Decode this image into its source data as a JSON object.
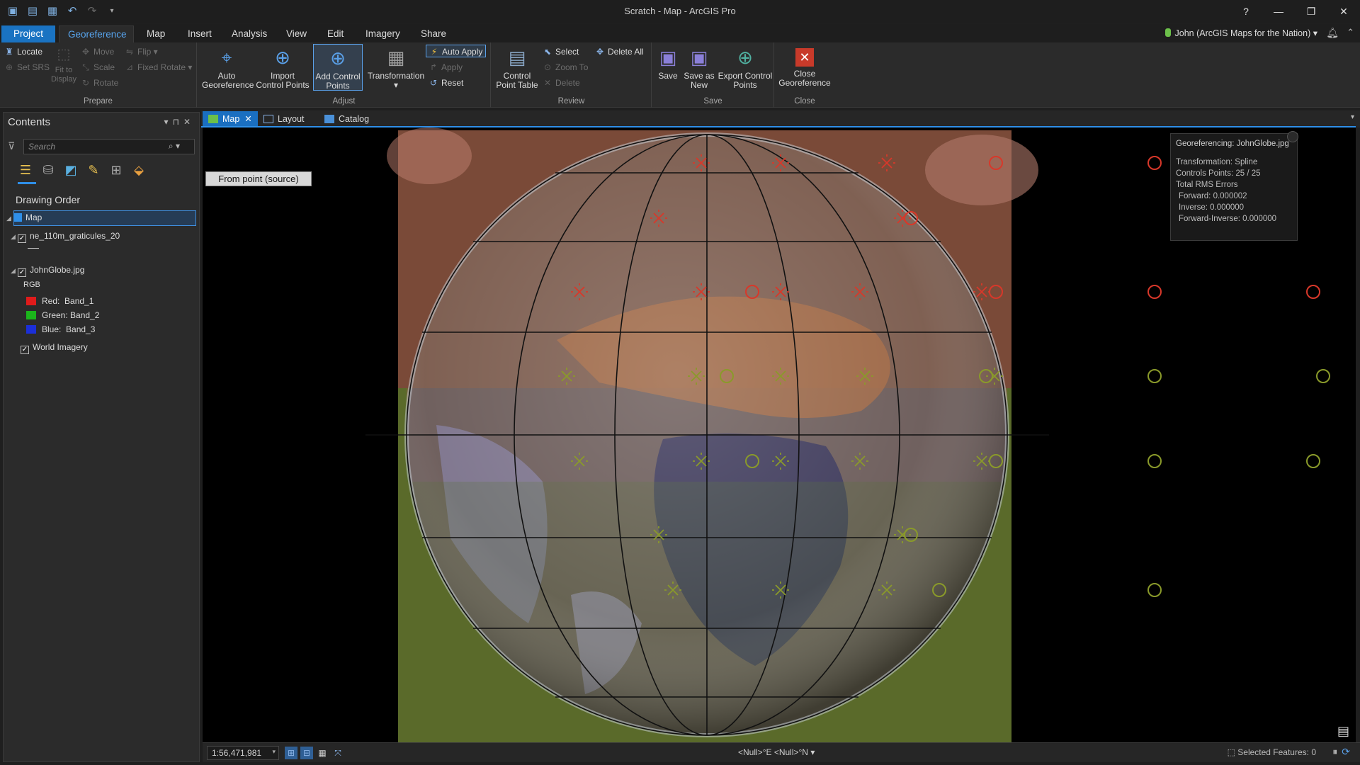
{
  "window": {
    "title": "Scratch - Map - ArcGIS Pro",
    "help": "?",
    "minimize": "—",
    "restore": "❐",
    "close": "✕"
  },
  "qat": {
    "icons": [
      "project-open-icon",
      "open-folder-icon",
      "save-icon",
      "undo-icon",
      "redo-icon",
      "customize-icon"
    ]
  },
  "tabs": [
    "Project",
    "Georeference",
    "Map",
    "Insert",
    "Analysis",
    "View",
    "Edit",
    "Imagery",
    "Share"
  ],
  "user": {
    "name": "John (ArcGIS Maps for the Nation)"
  },
  "ribbon": {
    "prepare": {
      "label": "Prepare",
      "locate": "Locate",
      "set_srs": "Set SRS",
      "fit_to_display": "Fit to\nDisplay",
      "move": "Move",
      "scale": "Scale",
      "rotate": "Rotate",
      "flip": "Flip",
      "fixed_rotate": "Fixed Rotate"
    },
    "adjust": {
      "label": "Adjust",
      "auto_georeference": "Auto\nGeoreference",
      "import_control_points": "Import\nControl Points",
      "add_control_points": "Add Control\nPoints",
      "transformation": "Transformation",
      "auto_apply": "Auto Apply",
      "apply": "Apply",
      "reset": "Reset"
    },
    "review": {
      "label": "Review",
      "control_point_table": "Control\nPoint Table",
      "select": "Select",
      "zoom_to": "Zoom To",
      "delete": "Delete",
      "delete_all": "Delete All"
    },
    "save": {
      "label": "Save",
      "save": "Save",
      "save_as_new": "Save as\nNew",
      "export_control_points": "Export Control\nPoints"
    },
    "close": {
      "label": "Close",
      "close_georeference": "Close\nGeoreference"
    }
  },
  "contents": {
    "title": "Contents",
    "search_placeholder": "Search",
    "drawing_order": "Drawing Order",
    "map": "Map",
    "layers": [
      {
        "name": "ne_110m_graticules_20",
        "checked": true
      },
      {
        "name": "JohnGlobe.jpg",
        "checked": true,
        "renderer": "RGB",
        "bands": [
          {
            "label": "Red:",
            "band": "Band_1",
            "color": "#e01b1b"
          },
          {
            "label": "Green:",
            "band": "Band_2",
            "color": "#1bb51b"
          },
          {
            "label": "Blue:",
            "band": "Band_3",
            "color": "#1b2fd8"
          }
        ]
      },
      {
        "name": "World Imagery",
        "checked": true
      }
    ]
  },
  "view_tabs": [
    {
      "label": "Map",
      "active": true
    },
    {
      "label": "Layout"
    },
    {
      "label": "Catalog"
    }
  ],
  "map": {
    "tooltip": "From point (source)",
    "georef_panel": {
      "title": "Georeferencing: JohnGlobe.jpg",
      "transformation": "Transformation: Spline",
      "control_points": "Controls Points: 25 / 25",
      "rms_title": "Total RMS Errors",
      "forward": "Forward: 0.000002",
      "inverse": "Inverse: 0.000000",
      "forward_inverse": "Forward-Inverse: 0.000000"
    }
  },
  "status": {
    "scale": "1:56,471,981",
    "coords": "<Null>°E <Null>°N",
    "selected_features": "Selected Features: 0"
  },
  "colors": {
    "accent": "#1a73c2",
    "cp_top": "#d8382a",
    "cp_bottom": "#8a9a2a"
  }
}
